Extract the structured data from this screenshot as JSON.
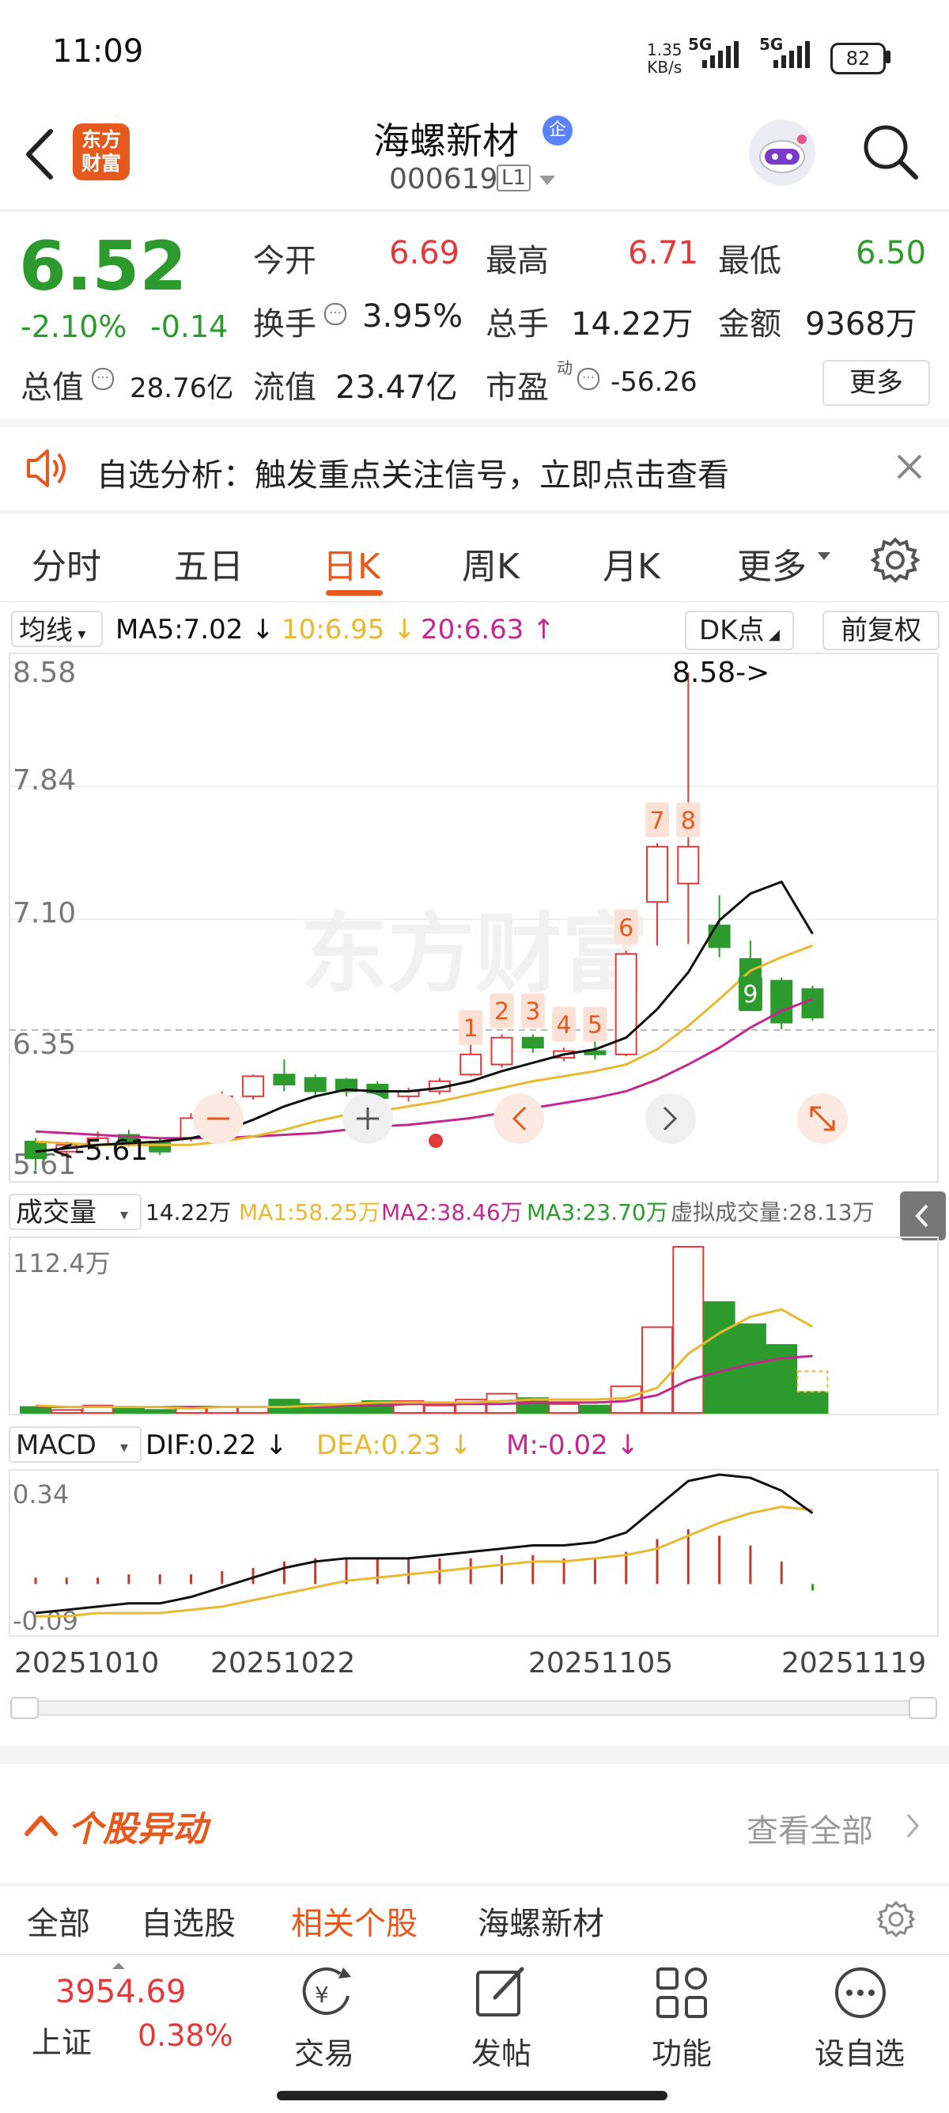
{
  "status": {
    "time": "11:09",
    "net_speed": "1.35",
    "net_unit": "KB/s",
    "sig1": "5G",
    "sig2": "5G",
    "battery": "82"
  },
  "header": {
    "logo_line1": "东方",
    "logo_line2": "财富",
    "stock_name": "海螺新材",
    "enterprise_badge": "企",
    "code": "000619",
    "level": "L1"
  },
  "quote": {
    "price": "6.52",
    "change_pct": "-2.10%",
    "change": "-0.14",
    "open_label": "今开",
    "open": "6.69",
    "high_label": "最高",
    "high": "6.71",
    "low_label": "最低",
    "low": "6.50",
    "turnover_label": "换手",
    "turnover": "3.95%",
    "volume_label": "总手",
    "volume": "14.22万",
    "amount_label": "金额",
    "amount": "9368万",
    "mktcap_label": "总值",
    "mktcap": "28.76亿",
    "float_label": "流值",
    "float": "23.47亿",
    "pe_label": "市盈",
    "pe_sup": "动",
    "pe": "-56.26",
    "more": "更多"
  },
  "notice": {
    "text": "自选分析：触发重点关注信号，立即点击查看"
  },
  "tabs": [
    "分时",
    "五日",
    "日K",
    "周K",
    "月K",
    "更多"
  ],
  "active_tab": 2,
  "colors": {
    "up": "#e23a3a",
    "down": "#2d9a2d",
    "ma5": "#111111",
    "ma10": "#e8b830",
    "ma20": "#c2288e",
    "accent": "#e55a1c"
  },
  "kline": {
    "ma_dropdown": "均线",
    "ma5": "MA5:7.02",
    "ma10": "10:6.95",
    "ma20": "20:6.63",
    "dk_button": "DK点",
    "fq_button": "前复权",
    "y_labels": [
      "8.58",
      "7.84",
      "7.10",
      "6.35",
      "5.61"
    ],
    "max_marker": "8.58->",
    "min_marker": "<-5.61",
    "watermark": "东方财富",
    "countdown": [
      "1",
      "2",
      "3",
      "4",
      "5",
      "6",
      "7",
      "8",
      "9"
    ],
    "vol_dropdown": "成交量",
    "vol_value": "14.22万",
    "vol_ma1": "MA1:58.25万",
    "vol_ma2": "MA2:38.46万",
    "vol_ma3": "MA3:23.70万",
    "vol_virtual": "虚拟成交量:28.13万",
    "vol_max": "112.4万",
    "macd_dropdown": "MACD",
    "dif": "DIF:0.22",
    "dea": "DEA:0.23",
    "m": "M:-0.02",
    "macd_max": "0.34",
    "macd_min": "-0.09",
    "dates": [
      "20251010",
      "20251022",
      "20251105",
      "20251119"
    ]
  },
  "chart_data": {
    "type": "candlestick",
    "ylim": [
      5.61,
      8.58
    ],
    "candles": [
      {
        "o": 5.78,
        "c": 5.68,
        "h": 5.8,
        "l": 5.61
      },
      {
        "o": 5.72,
        "c": 5.76,
        "h": 5.78,
        "l": 5.68
      },
      {
        "o": 5.76,
        "c": 5.8,
        "h": 5.84,
        "l": 5.74
      },
      {
        "o": 5.82,
        "c": 5.78,
        "h": 5.85,
        "l": 5.75
      },
      {
        "o": 5.78,
        "c": 5.72,
        "h": 5.8,
        "l": 5.7
      },
      {
        "o": 5.8,
        "c": 5.92,
        "h": 5.95,
        "l": 5.78
      },
      {
        "o": 5.94,
        "c": 6.05,
        "h": 6.08,
        "l": 5.92
      },
      {
        "o": 6.05,
        "c": 6.17,
        "h": 6.18,
        "l": 6.03
      },
      {
        "o": 6.18,
        "c": 6.12,
        "h": 6.27,
        "l": 6.08
      },
      {
        "o": 6.16,
        "c": 6.08,
        "h": 6.18,
        "l": 6.05
      },
      {
        "o": 6.15,
        "c": 6.08,
        "h": 6.16,
        "l": 6.05
      },
      {
        "o": 6.12,
        "c": 6.04,
        "h": 6.14,
        "l": 6.0
      },
      {
        "o": 6.05,
        "c": 6.08,
        "h": 6.1,
        "l": 6.02
      },
      {
        "o": 6.08,
        "c": 6.14,
        "h": 6.16,
        "l": 6.06
      },
      {
        "o": 6.18,
        "c": 6.3,
        "h": 6.45,
        "l": 6.17
      },
      {
        "o": 6.24,
        "c": 6.4,
        "h": 6.42,
        "l": 6.22
      },
      {
        "o": 6.4,
        "c": 6.34,
        "h": 6.42,
        "l": 6.31
      },
      {
        "o": 6.28,
        "c": 6.32,
        "h": 6.34,
        "l": 6.26
      },
      {
        "o": 6.32,
        "c": 6.3,
        "h": 6.38,
        "l": 6.27
      },
      {
        "o": 6.3,
        "c": 6.9,
        "h": 6.92,
        "l": 6.29
      },
      {
        "o": 7.21,
        "c": 7.54,
        "h": 7.56,
        "l": 6.95
      },
      {
        "o": 7.32,
        "c": 7.54,
        "h": 8.58,
        "l": 6.96
      },
      {
        "o": 7.07,
        "c": 6.94,
        "h": 7.25,
        "l": 6.88
      },
      {
        "o": 6.87,
        "c": 6.73,
        "h": 6.98,
        "l": 6.7
      },
      {
        "o": 6.74,
        "c": 6.49,
        "h": 6.76,
        "l": 6.45
      },
      {
        "o": 6.69,
        "c": 6.52,
        "h": 6.71,
        "l": 6.5
      }
    ],
    "ma5": [
      5.72,
      5.74,
      5.76,
      5.77,
      5.78,
      5.8,
      5.84,
      5.91,
      5.99,
      6.05,
      6.09,
      6.08,
      6.08,
      6.1,
      6.14,
      6.2,
      6.25,
      6.3,
      6.33,
      6.4,
      6.57,
      6.79,
      7.1,
      7.26,
      7.33,
      7.02
    ],
    "ma10": [
      5.78,
      5.77,
      5.76,
      5.76,
      5.76,
      5.76,
      5.78,
      5.81,
      5.85,
      5.9,
      5.94,
      5.96,
      5.99,
      6.02,
      6.06,
      6.1,
      6.14,
      6.17,
      6.2,
      6.24,
      6.33,
      6.47,
      6.63,
      6.8,
      6.88,
      6.95
    ],
    "ma20": [
      5.84,
      5.83,
      5.82,
      5.81,
      5.8,
      5.8,
      5.8,
      5.81,
      5.82,
      5.83,
      5.85,
      5.87,
      5.88,
      5.9,
      5.92,
      5.95,
      5.98,
      6.01,
      6.04,
      6.08,
      6.15,
      6.24,
      6.34,
      6.46,
      6.56,
      6.63
    ],
    "volume": [
      4,
      2,
      5,
      3,
      2,
      3,
      4,
      4,
      9,
      6,
      6,
      8,
      8,
      5,
      9,
      13,
      10,
      6,
      5,
      18,
      58,
      112.4,
      75,
      60,
      46,
      14.22
    ],
    "vol_ma1": [
      5,
      4,
      4,
      4,
      4,
      3,
      4,
      4,
      4,
      5,
      6,
      7,
      7,
      7,
      7,
      8,
      9,
      9,
      9,
      10,
      17,
      40,
      54,
      65,
      70,
      58.25
    ],
    "vol_ma2": [
      4,
      4,
      4,
      4,
      4,
      4,
      4,
      4,
      4,
      4,
      5,
      5,
      6,
      6,
      6,
      6,
      7,
      7,
      7,
      8,
      12,
      22,
      28,
      33,
      37,
      38.46
    ],
    "macd": [
      0.02,
      0.02,
      0.02,
      0.03,
      0.03,
      0.03,
      0.04,
      0.05,
      0.07,
      0.08,
      0.08,
      0.08,
      0.08,
      0.08,
      0.08,
      0.09,
      0.09,
      0.08,
      0.08,
      0.1,
      0.14,
      0.17,
      0.15,
      0.12,
      0.07,
      -0.02
    ],
    "dif": [
      -0.09,
      -0.08,
      -0.07,
      -0.06,
      -0.06,
      -0.04,
      -0.01,
      0.02,
      0.05,
      0.07,
      0.08,
      0.08,
      0.08,
      0.09,
      0.1,
      0.11,
      0.12,
      0.12,
      0.13,
      0.16,
      0.24,
      0.32,
      0.34,
      0.33,
      0.29,
      0.22
    ],
    "dea": [
      -0.1,
      -0.1,
      -0.09,
      -0.09,
      -0.09,
      -0.08,
      -0.07,
      -0.05,
      -0.03,
      -0.01,
      0.01,
      0.02,
      0.03,
      0.04,
      0.05,
      0.06,
      0.07,
      0.07,
      0.08,
      0.09,
      0.11,
      0.15,
      0.19,
      0.22,
      0.24,
      0.23
    ]
  },
  "dong": {
    "title": "个股异动",
    "view_all": "查看全部",
    "tabs": [
      "全部",
      "自选股",
      "相关个股",
      "海螺新材"
    ],
    "active": 2
  },
  "bottom": {
    "index_value": "3954.69",
    "index_name": "上证",
    "index_pct": "0.38%",
    "trade": "交易",
    "post": "发帖",
    "func": "功能",
    "add": "设自选"
  }
}
